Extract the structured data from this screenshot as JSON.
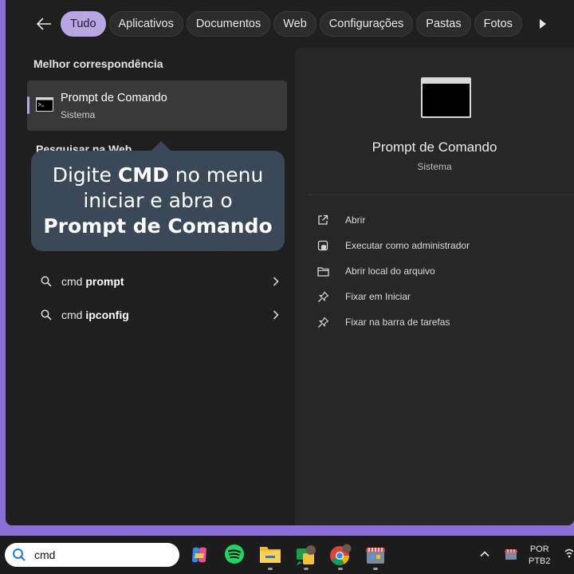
{
  "filters": {
    "back_label": "Voltar",
    "chips": [
      "Tudo",
      "Aplicativos",
      "Documentos",
      "Web",
      "Configurações",
      "Pastas",
      "Fotos"
    ],
    "active_index": 0
  },
  "best_match": {
    "section_title": "Melhor correspondência",
    "title": "Prompt de Comando",
    "subtitle": "Sistema"
  },
  "web": {
    "section_title": "Pesquisar na Web",
    "items": [
      {
        "prefix": "cmd",
        "suffix": "prompt"
      },
      {
        "prefix": "cmd",
        "suffix": "ipconfig"
      }
    ]
  },
  "tooltip": {
    "line1_pre": "Digite ",
    "line1_bold": "CMD",
    "line1_post": " no menu",
    "line2": "iniciar e abra o",
    "line3_bold": "Prompt de Comando"
  },
  "details": {
    "title": "Prompt de Comando",
    "subtitle": "Sistema",
    "actions": [
      {
        "label": "Abrir",
        "icon": "open-external-icon"
      },
      {
        "label": "Executar como administrador",
        "icon": "shield-admin-icon"
      },
      {
        "label": "Abrir local do arquivo",
        "icon": "folder-icon"
      },
      {
        "label": "Fixar em Iniciar",
        "icon": "pin-icon"
      },
      {
        "label": "Fixar na barra de tarefas",
        "icon": "pin-icon"
      }
    ]
  },
  "taskbar": {
    "search_value": "cmd",
    "apps": [
      "copilot-icon",
      "spotify-icon",
      "file-explorer-icon",
      "whatsapp-icon",
      "chrome-icon",
      "store-icon"
    ],
    "language_line1": "POR",
    "language_line2": "PTB2"
  },
  "colors": {
    "accent": "#b9a7e3",
    "tooltip_bg": "#3b4858",
    "desktop_bg": "#8a6fd6",
    "panel_bg": "#1f1f1f"
  }
}
